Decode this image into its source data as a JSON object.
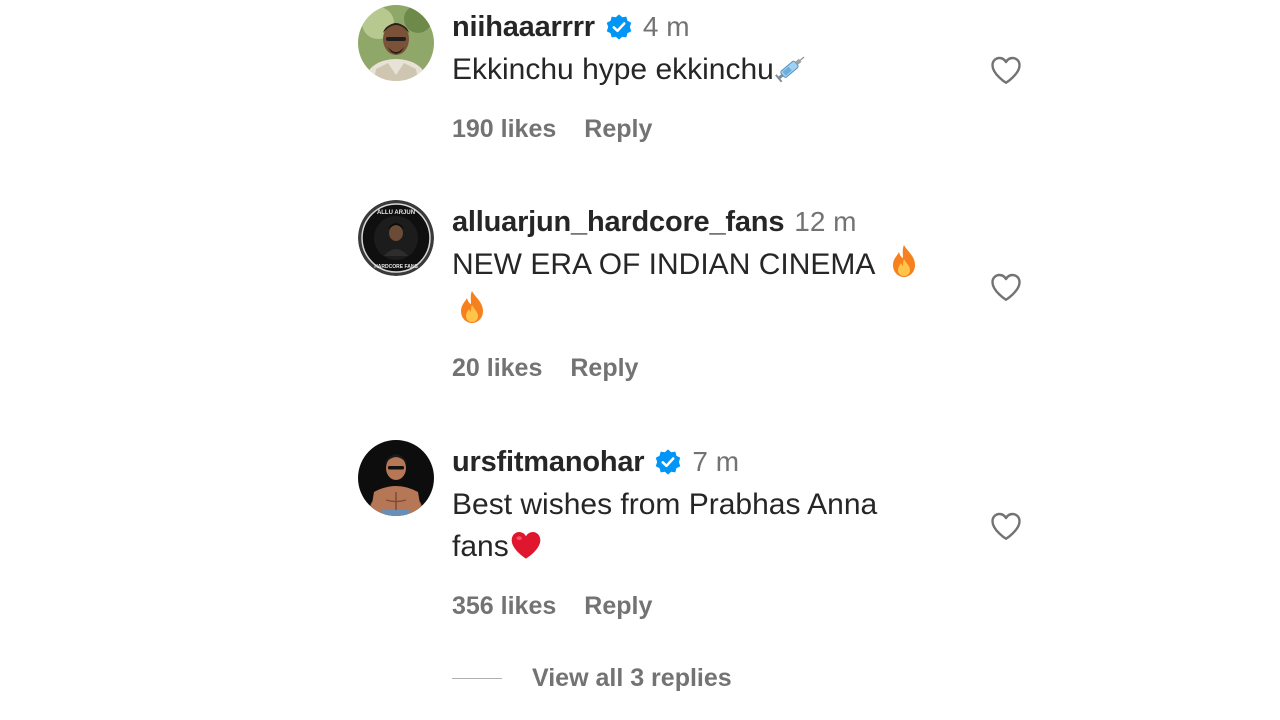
{
  "comments": [
    {
      "username": "niihaaarrrr",
      "verified": true,
      "time": "4 m",
      "text": "Ekkinchu hype ekkinchu",
      "emoji": "syringe-emoji",
      "likes": "190 likes",
      "reply": "Reply"
    },
    {
      "username": "alluarjun_hardcore_fans",
      "verified": false,
      "time": "12 m",
      "text": "NEW ERA OF INDIAN CINEMA",
      "emoji": "fire-emoji",
      "likes": "20 likes",
      "reply": "Reply"
    },
    {
      "username": "ursfitmanohar",
      "verified": true,
      "time": "7 m",
      "text_line1": "Best wishes from Prabhas Anna",
      "text_line2": "fans",
      "emoji": "red-heart-emoji",
      "likes": "356 likes",
      "reply": "Reply"
    }
  ],
  "view_replies": "View all 3 replies",
  "colors": {
    "verified_blue": "#0095f6",
    "muted_text": "#737373",
    "primary_text": "#262626"
  }
}
